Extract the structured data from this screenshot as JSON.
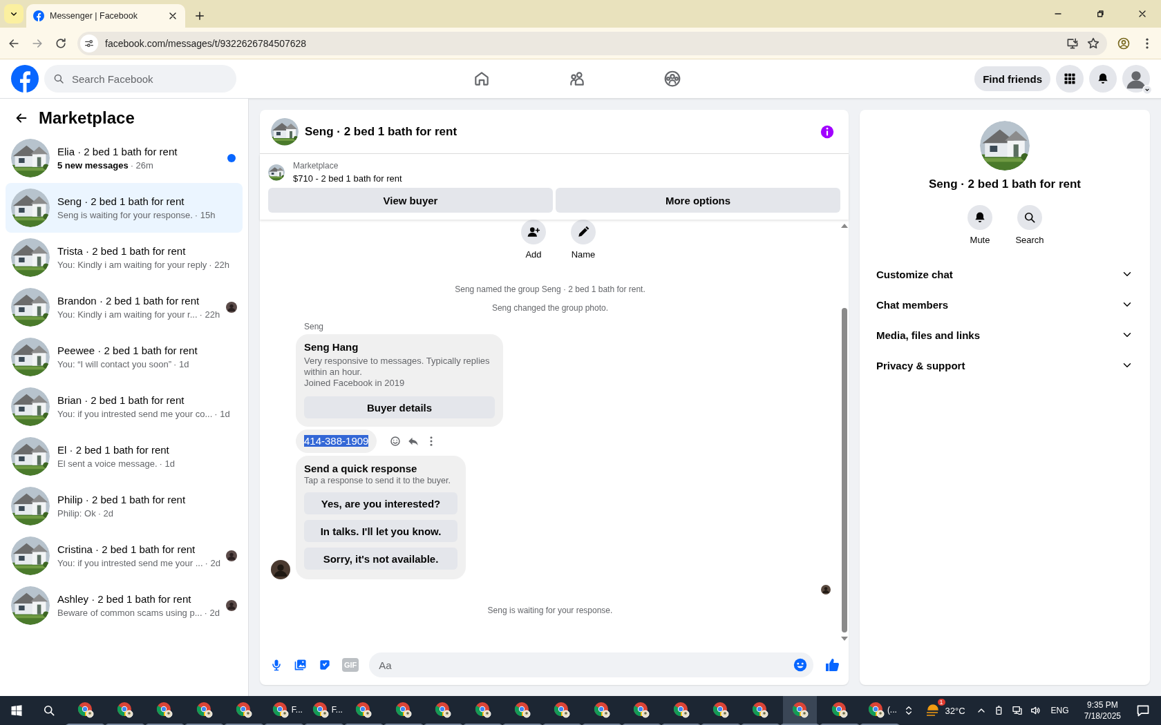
{
  "browser": {
    "tab_title": "Messenger | Facebook",
    "url": "facebook.com/messages/t/9322626784507628"
  },
  "header": {
    "search_placeholder": "Search Facebook",
    "find_friends": "Find friends"
  },
  "sidebar": {
    "title": "Marketplace",
    "conversations": [
      {
        "title": "Elia · 2 bed 1 bath for rent",
        "preview": "5 new messages",
        "time": "· 26m",
        "unread": true,
        "seen_avatar": false,
        "selected": false
      },
      {
        "title": "Seng · 2 bed 1 bath for rent",
        "preview": "Seng is waiting for your response.",
        "time": "· 15h",
        "unread": false,
        "seen_avatar": false,
        "selected": true
      },
      {
        "title": "Trista · 2 bed 1 bath for rent",
        "preview": "You: Kindly i am waiting for your reply",
        "time": "· 22h",
        "unread": false,
        "seen_avatar": false,
        "selected": false
      },
      {
        "title": "Brandon · 2 bed 1 bath for rent",
        "preview": "You: Kindly i am waiting for your r...",
        "time": "· 22h",
        "unread": false,
        "seen_avatar": true,
        "selected": false
      },
      {
        "title": "Peewee · 2 bed 1 bath for rent",
        "preview": "You: “I will contact you soon”",
        "time": "· 1d",
        "unread": false,
        "seen_avatar": false,
        "selected": false
      },
      {
        "title": "Brian · 2 bed 1 bath for rent",
        "preview": "You: if you intrested send me your co...",
        "time": "· 1d",
        "unread": false,
        "seen_avatar": false,
        "selected": false
      },
      {
        "title": "El · 2 bed 1 bath for rent",
        "preview": "El sent a voice message.",
        "time": "· 1d",
        "unread": false,
        "seen_avatar": false,
        "selected": false
      },
      {
        "title": "Philip · 2 bed 1 bath for rent",
        "preview": "Philip: Ok",
        "time": "· 2d",
        "unread": false,
        "seen_avatar": false,
        "selected": false
      },
      {
        "title": "Cristina · 2 bed 1 bath for rent",
        "preview": "You: if you intrested send me your ...",
        "time": "· 2d",
        "unread": false,
        "seen_avatar": true,
        "selected": false
      },
      {
        "title": "Ashley · 2 bed 1 bath for rent",
        "preview": "Beware of common scams using p...",
        "time": "· 2d",
        "unread": false,
        "seen_avatar": true,
        "selected": false
      }
    ]
  },
  "chat": {
    "title": "Seng · 2 bed 1 bath for rent",
    "listing": {
      "source": "Marketplace",
      "title": "$710 - 2 bed 1 bath for rent"
    },
    "buttons": [
      "View buyer",
      "More options"
    ],
    "group_actions": [
      "Add",
      "Name"
    ],
    "events": [
      "Seng named the group Seng · 2 bed 1 bath for rent.",
      "Seng changed the group photo."
    ],
    "sender": "Seng",
    "profile_card": {
      "name": "Seng Hang",
      "lines": [
        "Very responsive to messages. Typically replies within an hour.",
        "Joined Facebook in 2019"
      ],
      "button": "Buyer details"
    },
    "phone_message": {
      "text": "414-388-1909",
      "selected": true
    },
    "quick_response": {
      "title": "Send a quick response",
      "subtitle": "Tap a response to send it to the buyer.",
      "options": [
        "Yes, are you interested?",
        "In talks. I'll let you know.",
        "Sorry, it's not available."
      ]
    },
    "status": "Seng is waiting for your response.",
    "composer": {
      "placeholder": "Aa",
      "gif": "GIF"
    }
  },
  "details": {
    "title": "Seng · 2 bed 1 bath for rent",
    "actions": [
      "Mute",
      "Search"
    ],
    "sections": [
      {
        "label": "Customize chat",
        "expanded": false
      },
      {
        "label": "Chat members",
        "expanded": false
      },
      {
        "label": "Media, files and links",
        "expanded": false
      },
      {
        "label": "Privacy & support",
        "expanded": false
      }
    ]
  },
  "taskbar": {
    "apps": [
      {
        "selected": false
      },
      {
        "selected": false
      },
      {
        "selected": false
      },
      {
        "selected": false
      },
      {
        "selected": false
      },
      {
        "label": "F...",
        "selected": false
      },
      {
        "label": "F...",
        "selected": false
      },
      {
        "selected": false
      },
      {
        "selected": false
      },
      {
        "selected": false
      },
      {
        "selected": false
      },
      {
        "selected": false
      },
      {
        "selected": false
      },
      {
        "selected": false
      },
      {
        "selected": false
      },
      {
        "selected": false
      },
      {
        "selected": false
      },
      {
        "selected": false
      },
      {
        "selected": true
      },
      {
        "selected": false
      },
      {
        "label": "(...",
        "selected": false
      }
    ],
    "weather": {
      "temperature": "32°C",
      "badge": "1"
    },
    "language": "ENG",
    "time": "9:35 PM",
    "date": "7/18/2025"
  }
}
